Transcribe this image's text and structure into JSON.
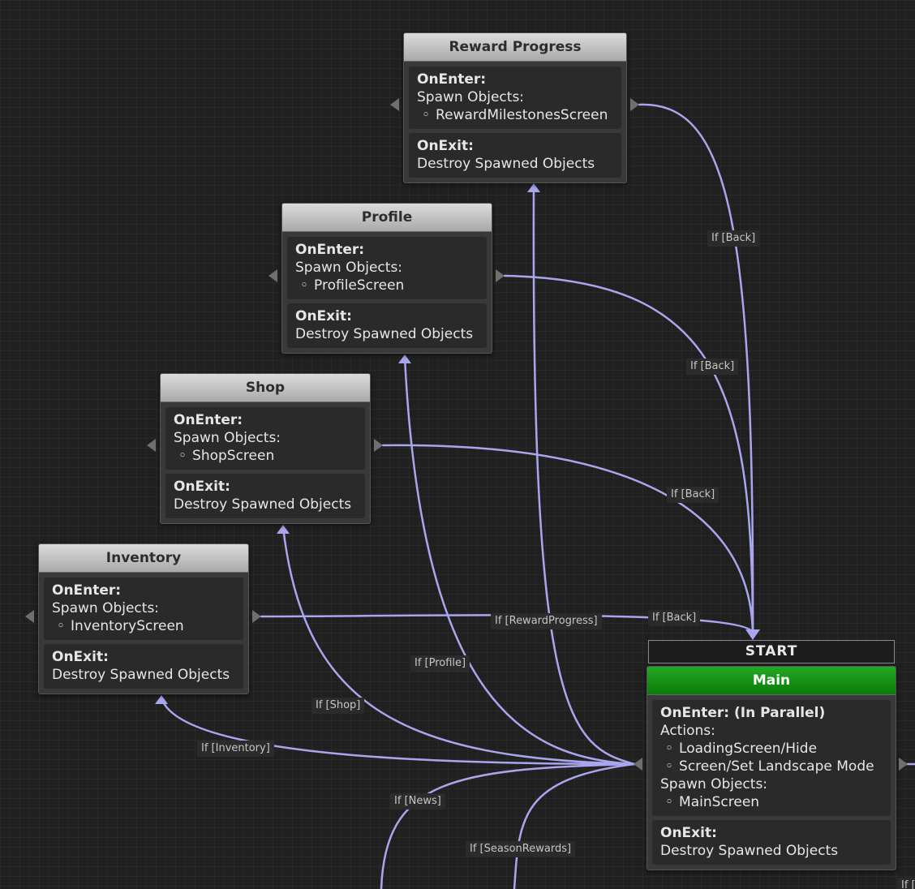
{
  "colors": {
    "edge": "#a9a6ee",
    "main_header": "#0e8a0e",
    "canvas": "#202020"
  },
  "nodes": {
    "reward": {
      "title": "Reward Progress",
      "on_enter_label": "OnEnter:",
      "on_enter_line": "Spawn Objects:",
      "on_enter_item": "RewardMilestonesScreen",
      "on_exit_label": "OnExit:",
      "on_exit_line": "Destroy Spawned Objects"
    },
    "profile": {
      "title": "Profile",
      "on_enter_label": "OnEnter:",
      "on_enter_line": "Spawn Objects:",
      "on_enter_item": "ProfileScreen",
      "on_exit_label": "OnExit:",
      "on_exit_line": "Destroy Spawned Objects"
    },
    "shop": {
      "title": "Shop",
      "on_enter_label": "OnEnter:",
      "on_enter_line": "Spawn Objects:",
      "on_enter_item": "ShopScreen",
      "on_exit_label": "OnExit:",
      "on_exit_line": "Destroy Spawned Objects"
    },
    "inventory": {
      "title": "Inventory",
      "on_enter_label": "OnEnter:",
      "on_enter_line": "Spawn Objects:",
      "on_enter_item": "InventoryScreen",
      "on_exit_label": "OnExit:",
      "on_exit_line": "Destroy Spawned Objects"
    },
    "main": {
      "start_label": "START",
      "title": "Main",
      "on_enter_label": "OnEnter: (In Parallel)",
      "actions_label": "Actions:",
      "action_1": "LoadingScreen/Hide",
      "action_2": "Screen/Set Landscape Mode",
      "spawn_label": "Spawn Objects:",
      "spawn_item": "MainScreen",
      "on_exit_label": "OnExit:",
      "on_exit_line": "Destroy Spawned Objects"
    }
  },
  "edge_labels": {
    "back_reward": "If [Back]",
    "back_profile": "If [Back]",
    "back_shop": "If [Back]",
    "back_inventory": "If [Back]",
    "reward_progress": "If [RewardProgress]",
    "profile": "If [Profile]",
    "shop": "If [Shop]",
    "inventory": "If [Inventory]",
    "news": "If [News]",
    "season_rewards": "If [SeasonRewards]",
    "cut_off": "If ["
  }
}
